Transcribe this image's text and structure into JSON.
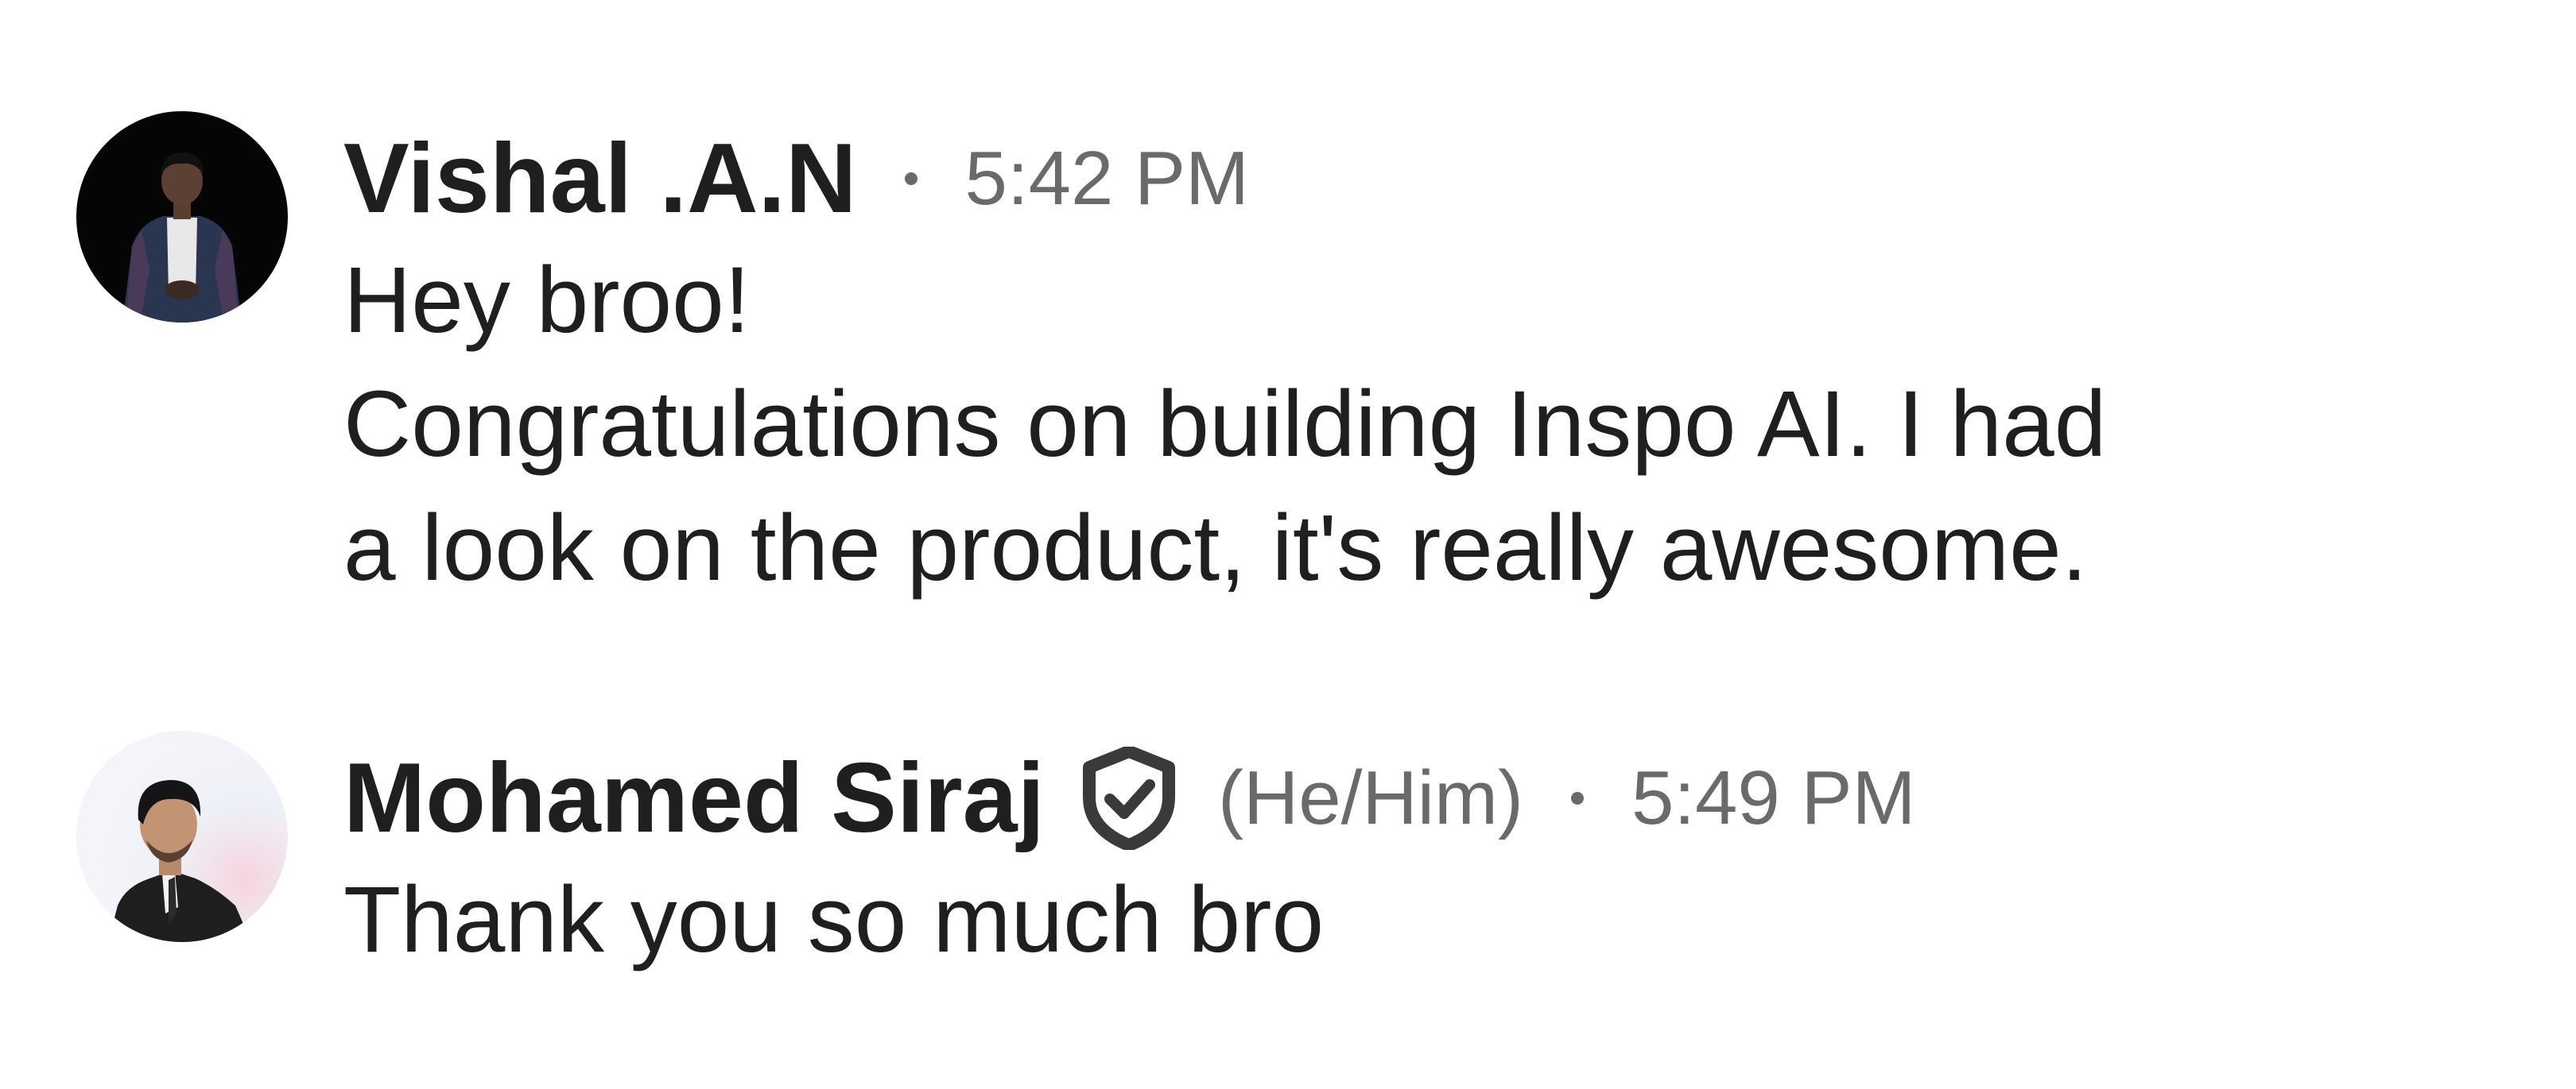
{
  "messages": [
    {
      "sender": "Vishal .A.N",
      "time": "5:42 PM",
      "avatar_icon": "profile-photo-icon",
      "lines": [
        "Hey broo!",
        "Congratulations on building Inspo AI. I had",
        "a look on the product, it's really awesome."
      ]
    },
    {
      "sender": "Mohamed Siraj",
      "verified_icon": "verified-shield-check-icon",
      "pronouns": "(He/Him)",
      "time": "5:49 PM",
      "avatar_icon": "profile-photo-icon",
      "lines": [
        "Thank you so much bro"
      ]
    }
  ],
  "colors": {
    "text_primary": "#1f1f1f",
    "text_secondary": "#6a6a6a",
    "background": "#ffffff"
  }
}
